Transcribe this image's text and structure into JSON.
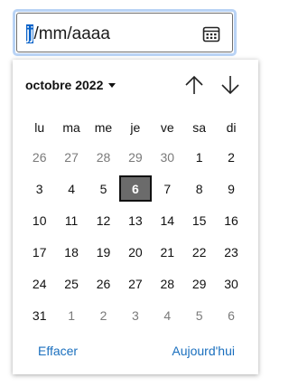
{
  "date_input": {
    "segment_day": "jj",
    "rest": "/mm/aaaa",
    "calendar_icon": "calendar-icon"
  },
  "picker": {
    "month_label": "octobre 2022",
    "prev_icon": "arrow-up-icon",
    "next_icon": "arrow-down-icon",
    "weekdays": [
      "lu",
      "ma",
      "me",
      "je",
      "ve",
      "sa",
      "di"
    ],
    "weeks": [
      [
        {
          "d": "26",
          "o": true
        },
        {
          "d": "27",
          "o": true
        },
        {
          "d": "28",
          "o": true
        },
        {
          "d": "29",
          "o": true
        },
        {
          "d": "30",
          "o": true
        },
        {
          "d": "1"
        },
        {
          "d": "2"
        }
      ],
      [
        {
          "d": "3"
        },
        {
          "d": "4"
        },
        {
          "d": "5"
        },
        {
          "d": "6",
          "today": true
        },
        {
          "d": "7"
        },
        {
          "d": "8"
        },
        {
          "d": "9"
        }
      ],
      [
        {
          "d": "10"
        },
        {
          "d": "11"
        },
        {
          "d": "12"
        },
        {
          "d": "13"
        },
        {
          "d": "14"
        },
        {
          "d": "15"
        },
        {
          "d": "16"
        }
      ],
      [
        {
          "d": "17"
        },
        {
          "d": "18"
        },
        {
          "d": "19"
        },
        {
          "d": "20"
        },
        {
          "d": "21"
        },
        {
          "d": "22"
        },
        {
          "d": "23"
        }
      ],
      [
        {
          "d": "24"
        },
        {
          "d": "25"
        },
        {
          "d": "26"
        },
        {
          "d": "27"
        },
        {
          "d": "28"
        },
        {
          "d": "29"
        },
        {
          "d": "30"
        }
      ],
      [
        {
          "d": "31"
        },
        {
          "d": "1",
          "o": true
        },
        {
          "d": "2",
          "o": true
        },
        {
          "d": "3",
          "o": true
        },
        {
          "d": "4",
          "o": true
        },
        {
          "d": "5",
          "o": true
        },
        {
          "d": "6",
          "o": true
        }
      ]
    ],
    "clear_label": "Effacer",
    "today_label": "Aujourd'hui"
  }
}
